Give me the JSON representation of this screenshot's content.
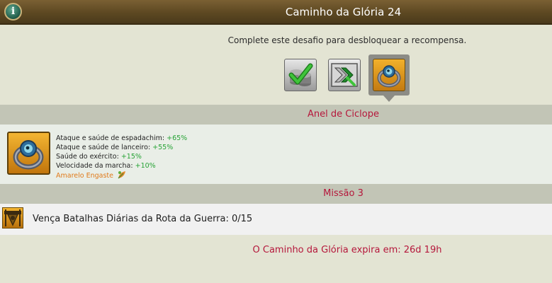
{
  "window": {
    "title": "Caminho da Glória 24",
    "info_icon_glyph": "i"
  },
  "intro": {
    "text": "Complete este desafio para desbloquear a recompensa.",
    "rewards": [
      {
        "icon": "coin-stack-check-icon",
        "state": "completed"
      },
      {
        "icon": "speedup-chevrons-icon",
        "state": "locked"
      },
      {
        "icon": "cyclops-ring-icon",
        "state": "selected"
      }
    ]
  },
  "ring": {
    "section_title": "Anel de Ciclope",
    "stats": [
      {
        "label": "Ataque e saúde de espadachim:",
        "value": "+65%"
      },
      {
        "label": "Ataque e saúde de lanceiro:",
        "value": "+55%"
      },
      {
        "label": "Saúde do exército:",
        "value": "+15%"
      },
      {
        "label": "Velocidade da marcha:",
        "value": "+10%"
      }
    ],
    "setting": "Amarelo Engaste",
    "colors": {
      "positive": "#27a336",
      "setting": "#e07a1a",
      "header_text": "#b5173b"
    }
  },
  "mission": {
    "section_title": "Missão 3",
    "text": "Vença Batalhas Diárias da Rota da Guerra: 0/15",
    "progress": {
      "current": 0,
      "total": 15
    }
  },
  "footer": {
    "expire_text": "O Caminho da Glória expira em: 26d 19h"
  }
}
